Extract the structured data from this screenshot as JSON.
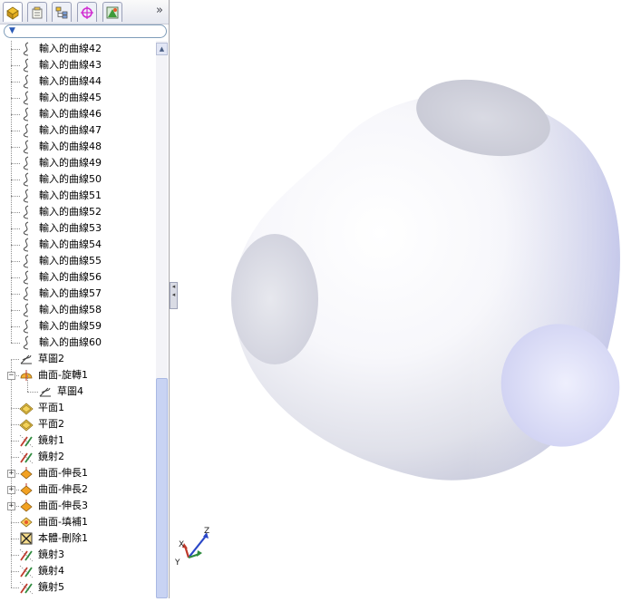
{
  "feature_tree": {
    "filter_icon": "funnel-icon",
    "tabs": [
      {
        "name": "feature-manager",
        "icon": "featuremanager-icon"
      },
      {
        "name": "property-manager",
        "icon": "propertymanager-icon"
      },
      {
        "name": "configuration-manager",
        "icon": "configurationmanager-icon"
      },
      {
        "name": "dimxpert-manager",
        "icon": "dimxpert-icon"
      },
      {
        "name": "display-manager",
        "icon": "displaymanager-icon"
      }
    ],
    "more_tabs": "»",
    "items": [
      {
        "label": "輸入的曲線42",
        "icon": "curve-icon",
        "level": 1
      },
      {
        "label": "輸入的曲線43",
        "icon": "curve-icon",
        "level": 1
      },
      {
        "label": "輸入的曲線44",
        "icon": "curve-icon",
        "level": 1
      },
      {
        "label": "輸入的曲線45",
        "icon": "curve-icon",
        "level": 1
      },
      {
        "label": "輸入的曲線46",
        "icon": "curve-icon",
        "level": 1
      },
      {
        "label": "輸入的曲線47",
        "icon": "curve-icon",
        "level": 1
      },
      {
        "label": "輸入的曲線48",
        "icon": "curve-icon",
        "level": 1
      },
      {
        "label": "輸入的曲線49",
        "icon": "curve-icon",
        "level": 1
      },
      {
        "label": "輸入的曲線50",
        "icon": "curve-icon",
        "level": 1
      },
      {
        "label": "輸入的曲線51",
        "icon": "curve-icon",
        "level": 1
      },
      {
        "label": "輸入的曲線52",
        "icon": "curve-icon",
        "level": 1
      },
      {
        "label": "輸入的曲線53",
        "icon": "curve-icon",
        "level": 1
      },
      {
        "label": "輸入的曲線54",
        "icon": "curve-icon",
        "level": 1
      },
      {
        "label": "輸入的曲線55",
        "icon": "curve-icon",
        "level": 1
      },
      {
        "label": "輸入的曲線56",
        "icon": "curve-icon",
        "level": 1
      },
      {
        "label": "輸入的曲線57",
        "icon": "curve-icon",
        "level": 1
      },
      {
        "label": "輸入的曲線58",
        "icon": "curve-icon",
        "level": 1
      },
      {
        "label": "輸入的曲線59",
        "icon": "curve-icon",
        "level": 1
      },
      {
        "label": "輸入的曲線60",
        "icon": "curve-icon",
        "level": 1
      },
      {
        "label": "草圖2",
        "icon": "sketch-icon",
        "level": 0
      },
      {
        "label": "曲面-旋轉1",
        "icon": "revolve-surface-icon",
        "level": 0,
        "expander": "−"
      },
      {
        "label": "草圖4",
        "icon": "sketch-icon",
        "level": 2
      },
      {
        "label": "平面1",
        "icon": "plane-icon",
        "level": 0
      },
      {
        "label": "平面2",
        "icon": "plane-icon",
        "level": 0
      },
      {
        "label": "鏡射1",
        "icon": "mirror-icon",
        "level": 0
      },
      {
        "label": "鏡射2",
        "icon": "mirror-icon",
        "level": 0
      },
      {
        "label": "曲面-伸長1",
        "icon": "extrude-surface-icon",
        "level": 0,
        "expander": "+"
      },
      {
        "label": "曲面-伸長2",
        "icon": "extrude-surface-icon",
        "level": 0,
        "expander": "+"
      },
      {
        "label": "曲面-伸長3",
        "icon": "extrude-surface-icon",
        "level": 0,
        "expander": "+"
      },
      {
        "label": "曲面-填補1",
        "icon": "fill-surface-icon",
        "level": 0
      },
      {
        "label": "本體-刪除1",
        "icon": "delete-body-icon",
        "level": 0
      },
      {
        "label": "鏡射3",
        "icon": "mirror-icon",
        "level": 0
      },
      {
        "label": "鏡射4",
        "icon": "mirror-icon",
        "level": 0
      },
      {
        "label": "鏡射5",
        "icon": "mirror-icon",
        "level": 0
      }
    ]
  },
  "scrollbar": {
    "position": 0.6,
    "visible_fraction": 0.4
  },
  "triad": {
    "x": "X",
    "y": "Y",
    "z": "Z"
  },
  "colors": {
    "x_axis": "#c0392b",
    "y_axis": "#2e8b3e",
    "z_axis": "#2a47c7",
    "model_light": "#ffffff",
    "model_shadow": "#b9bdd6",
    "model_edge_tint": "#c5c9f0"
  }
}
